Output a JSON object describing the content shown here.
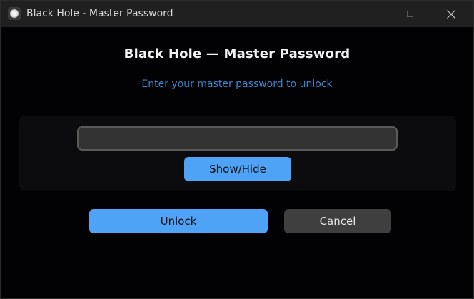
{
  "window": {
    "title": "Black Hole - Master Password",
    "controls": {
      "minimize_icon": "minimize-icon",
      "maximize_icon": "maximize-icon",
      "close_icon": "close-icon"
    }
  },
  "dialog": {
    "heading": "Black Hole — Master Password",
    "subheading": "Enter your master password to unlock",
    "password_field": {
      "value": "",
      "placeholder": ""
    },
    "show_hide_label": "Show/Hide",
    "unlock_label": "Unlock",
    "cancel_label": "Cancel"
  },
  "colors": {
    "accent": "#4ea3f7",
    "subtitle": "#3c84c8",
    "background": "#020205",
    "titlebar": "#202020",
    "secondary_button": "#3f3f3f"
  }
}
